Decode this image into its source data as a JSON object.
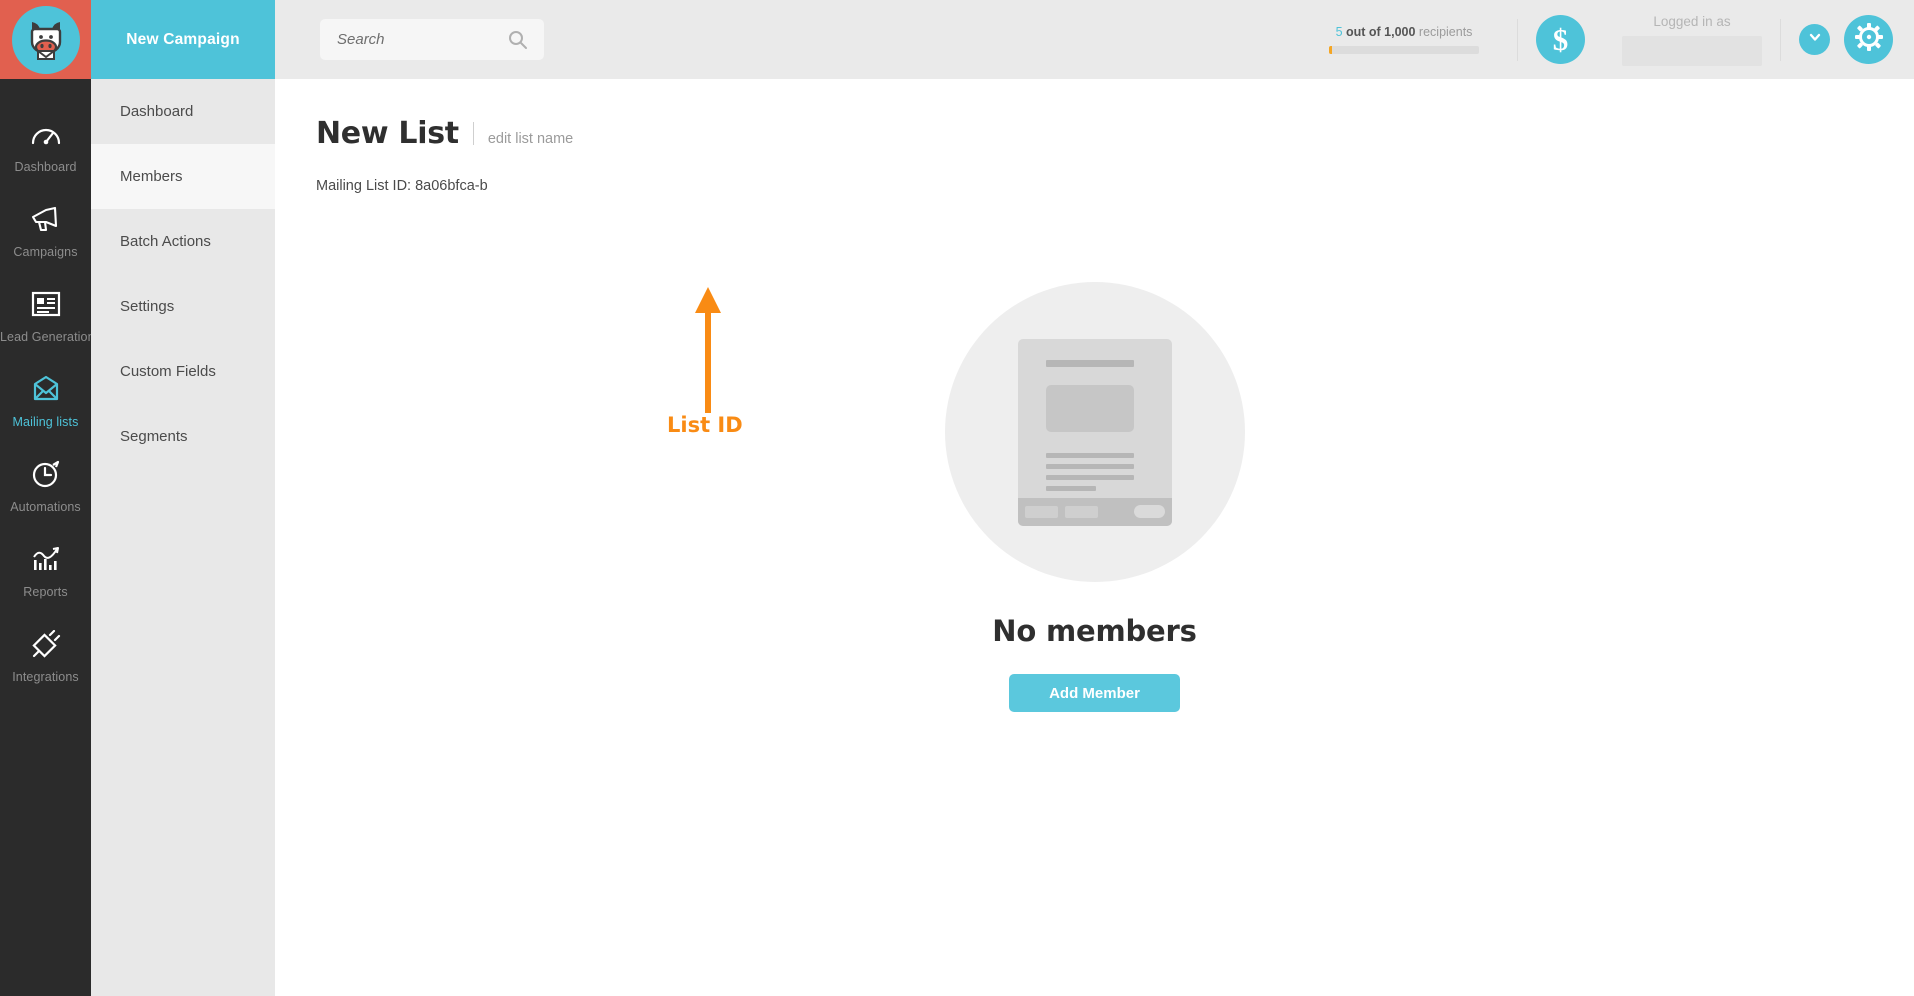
{
  "brand": {
    "logo_icon": "cow-head-logo",
    "accent_color": "#4ec3d9",
    "logo_bg_color": "#e1604f",
    "annotation_color": "#f98b14"
  },
  "rail": {
    "items": [
      {
        "label": "Dashboard",
        "icon": "gauge-icon",
        "active": false
      },
      {
        "label": "Campaigns",
        "icon": "megaphone-icon",
        "active": false
      },
      {
        "label": "Lead Generation",
        "icon": "form-icon",
        "active": false
      },
      {
        "label": "Mailing lists",
        "icon": "envelope-icon",
        "active": true
      },
      {
        "label": "Automations",
        "icon": "stopwatch-icon",
        "active": false
      },
      {
        "label": "Reports",
        "icon": "bar-chart-icon",
        "active": false
      },
      {
        "label": "Integrations",
        "icon": "plug-icon",
        "active": false
      }
    ]
  },
  "subnav": {
    "header_label": "New Campaign",
    "items": [
      {
        "label": "Dashboard",
        "current": false
      },
      {
        "label": "Members",
        "current": true
      },
      {
        "label": "Batch Actions",
        "current": false
      },
      {
        "label": "Settings",
        "current": false
      },
      {
        "label": "Custom Fields",
        "current": false
      },
      {
        "label": "Segments",
        "current": false
      }
    ]
  },
  "header": {
    "search": {
      "value": "",
      "placeholder": "Search",
      "icon": "search-icon"
    },
    "quota": {
      "count": "5",
      "middle": " out of 1,000 ",
      "unit": "recipients",
      "fill_percent": 2,
      "fill_color": "#f5a623"
    },
    "billing_button": {
      "icon": "dollar-icon",
      "glyph": "$"
    },
    "account": {
      "label": "Logged in as",
      "value": ""
    },
    "dropdown_button": {
      "icon": "chevron-down-icon"
    },
    "settings_button": {
      "icon": "gear-icon"
    }
  },
  "main": {
    "title": "New List",
    "edit_link": "edit list name",
    "list_id_text": "Mailing List ID: 8a06bfca-b",
    "annotation": {
      "label": "List ID",
      "arrow": "up-arrow-annotation"
    },
    "empty_state": {
      "illustration": "document-placeholder-illustration",
      "title": "No members",
      "action_label": "Add Member"
    }
  }
}
